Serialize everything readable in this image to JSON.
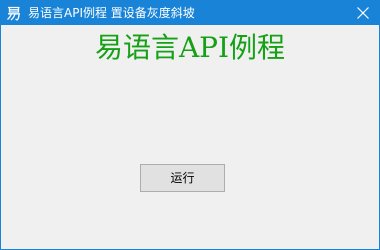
{
  "window": {
    "title": "易语言API例程 置设备灰度斜坡",
    "app_icon": "yi-language-icon",
    "close_icon": "close-icon"
  },
  "main": {
    "heading": "易语言API例程",
    "run_button_label": "运行"
  },
  "colors": {
    "titlebar": "#1883d7",
    "heading": "#16a016",
    "client_background": "#f0f0f0",
    "button_background": "#e1e1e1"
  }
}
